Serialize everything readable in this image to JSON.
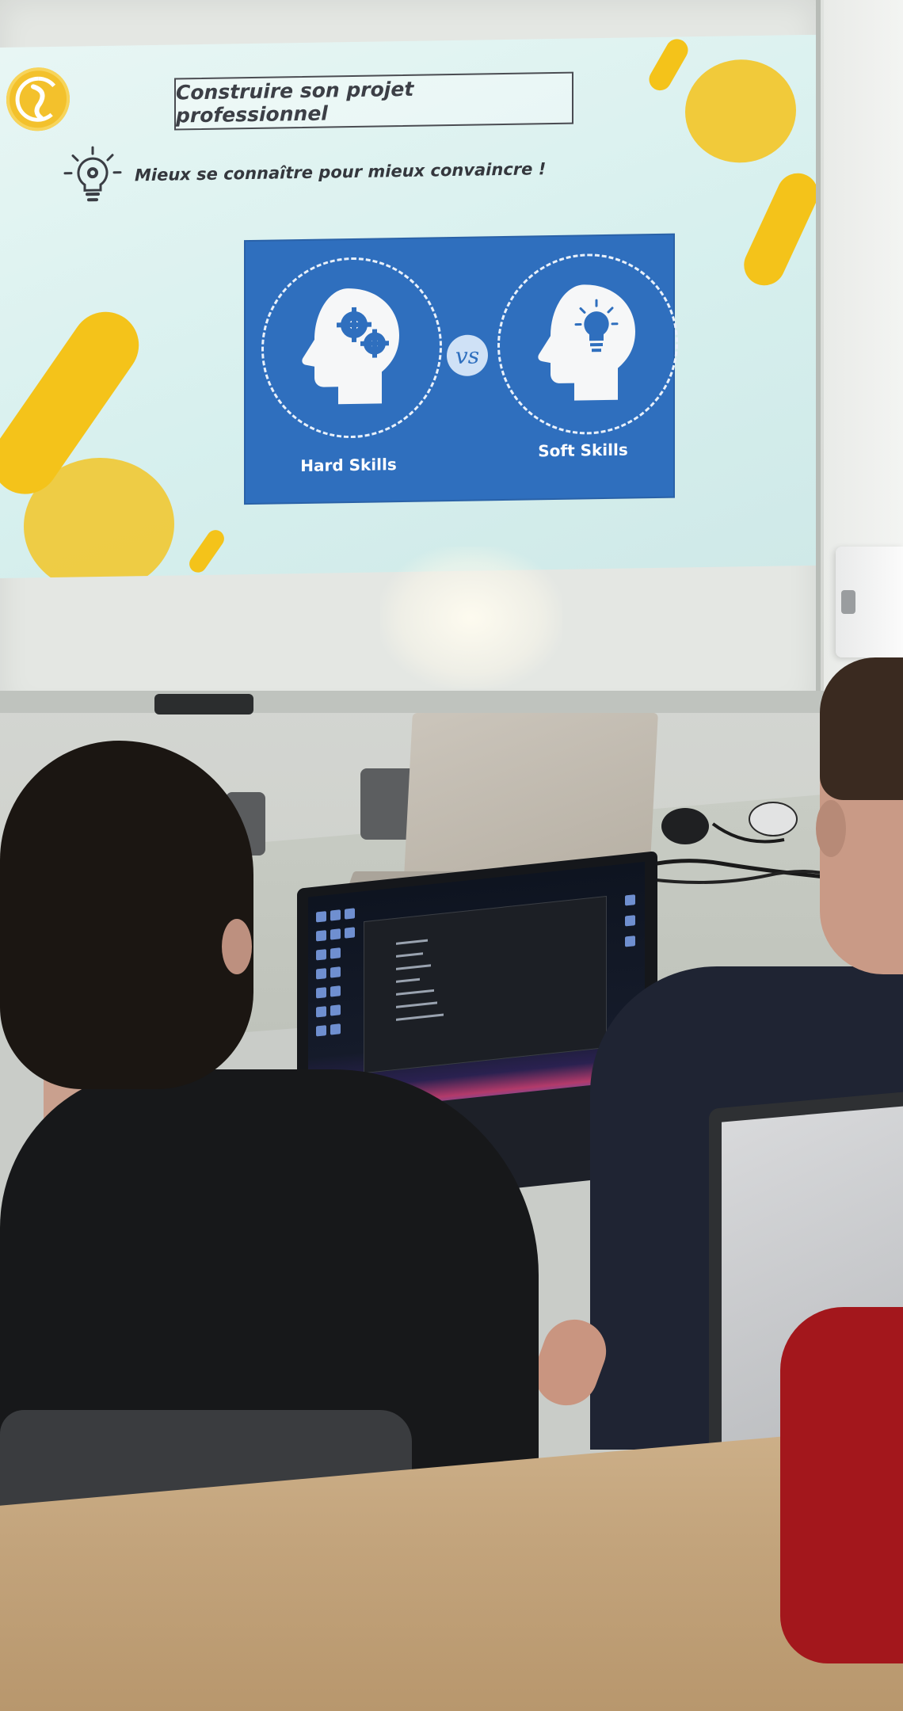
{
  "slide": {
    "title": "Construire son projet professionnel",
    "subtitle": "Mieux se connaître pour mieux convaincre !",
    "vs_label": "vs",
    "left_skill_label": "Hard Skills",
    "right_skill_label": "Soft Skills"
  },
  "colors": {
    "slide_background": "#d7f0ee",
    "panel_blue": "#2f6fbe",
    "accent_yellow": "#f4c31a",
    "title_text": "#3c3f46"
  },
  "icons": [
    "logo-icon",
    "lightbulb-gear-icon",
    "head-gears-icon",
    "head-lightbulb-icon"
  ]
}
